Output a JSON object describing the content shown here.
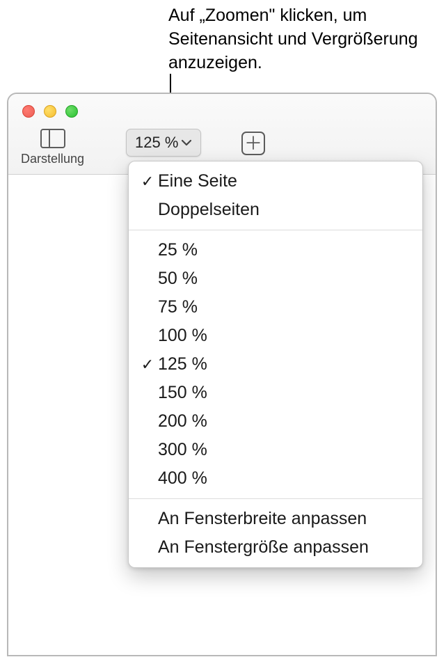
{
  "callout": "Auf „Zoomen\" klicken, um Seitenansicht und Vergrößerung anzuzeigen.",
  "toolbar": {
    "view_label": "Darstellung",
    "zoom_value": "125 %"
  },
  "menu": {
    "sections": [
      {
        "items": [
          {
            "label": "Eine Seite",
            "checked": true
          },
          {
            "label": "Doppelseiten",
            "checked": false
          }
        ]
      },
      {
        "items": [
          {
            "label": "25 %",
            "checked": false
          },
          {
            "label": "50 %",
            "checked": false
          },
          {
            "label": "75 %",
            "checked": false
          },
          {
            "label": "100 %",
            "checked": false
          },
          {
            "label": "125 %",
            "checked": true
          },
          {
            "label": "150 %",
            "checked": false
          },
          {
            "label": "200 %",
            "checked": false
          },
          {
            "label": "300 %",
            "checked": false
          },
          {
            "label": "400 %",
            "checked": false
          }
        ]
      },
      {
        "items": [
          {
            "label": "An Fensterbreite anpassen",
            "checked": false
          },
          {
            "label": "An Fenstergröße anpassen",
            "checked": false
          }
        ]
      }
    ]
  }
}
